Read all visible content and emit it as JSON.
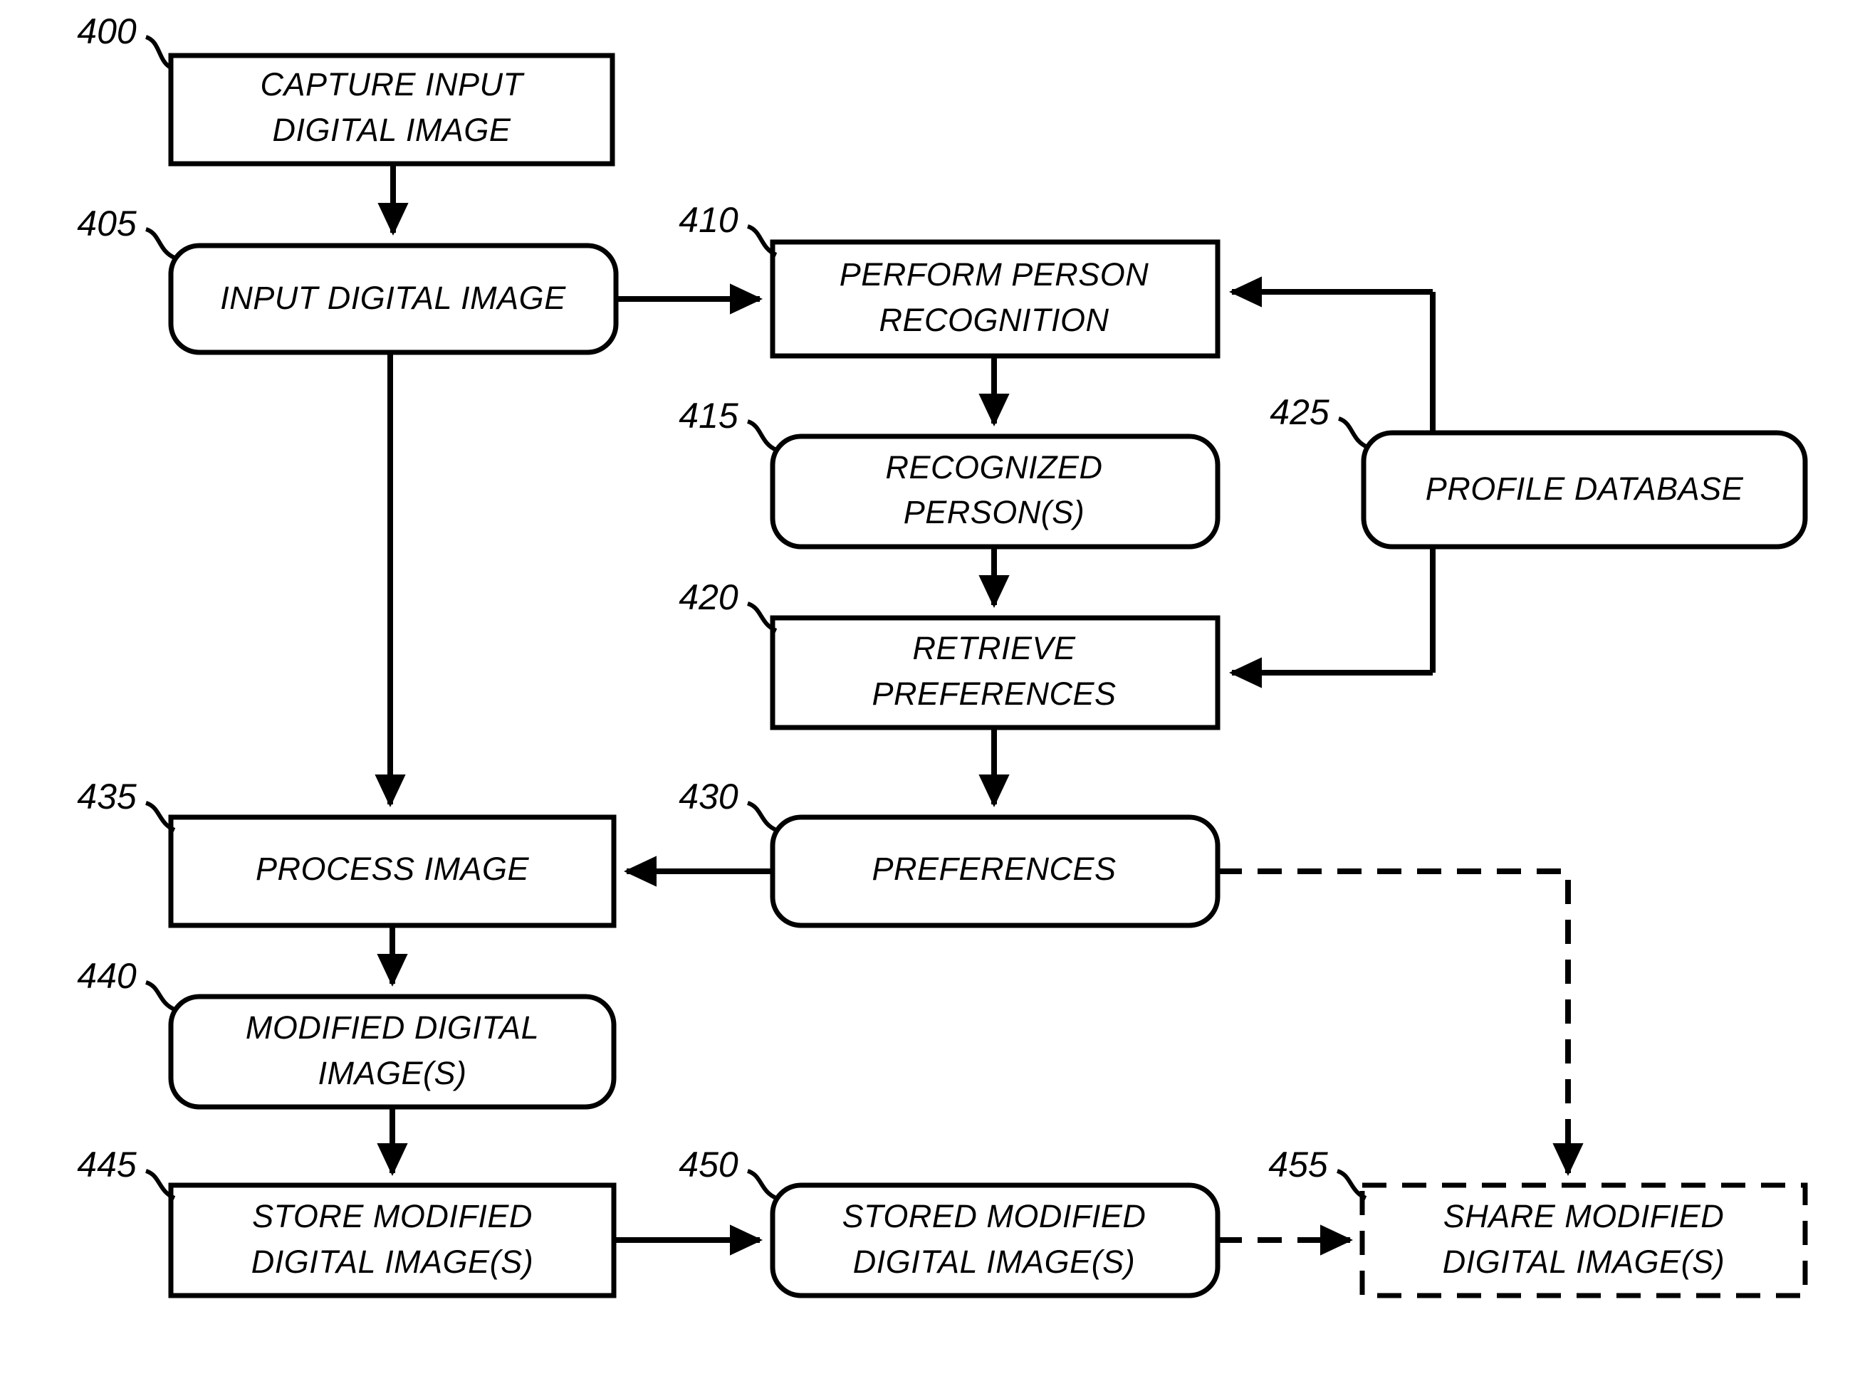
{
  "figure": {
    "type": "patent-flowchart",
    "nodes": [
      {
        "ref": "400",
        "label_lines": [
          "CAPTURE INPUT",
          "DIGITAL IMAGE"
        ],
        "shape": "rectangle",
        "line_style": "solid"
      },
      {
        "ref": "405",
        "label_lines": [
          "INPUT DIGITAL IMAGE"
        ],
        "shape": "rounded-rectangle",
        "line_style": "solid"
      },
      {
        "ref": "410",
        "label_lines": [
          "PERFORM PERSON",
          "RECOGNITION"
        ],
        "shape": "rectangle",
        "line_style": "solid"
      },
      {
        "ref": "415",
        "label_lines": [
          "RECOGNIZED",
          "PERSON(S)"
        ],
        "shape": "rounded-rectangle",
        "line_style": "solid"
      },
      {
        "ref": "420",
        "label_lines": [
          "RETRIEVE",
          "PREFERENCES"
        ],
        "shape": "rectangle",
        "line_style": "solid"
      },
      {
        "ref": "425",
        "label_lines": [
          "PROFILE DATABASE"
        ],
        "shape": "rounded-rectangle",
        "line_style": "solid"
      },
      {
        "ref": "430",
        "label_lines": [
          "PREFERENCES"
        ],
        "shape": "rounded-rectangle",
        "line_style": "solid"
      },
      {
        "ref": "435",
        "label_lines": [
          "PROCESS IMAGE"
        ],
        "shape": "rectangle",
        "line_style": "solid"
      },
      {
        "ref": "440",
        "label_lines": [
          "MODIFIED DIGITAL",
          "IMAGE(S)"
        ],
        "shape": "rounded-rectangle",
        "line_style": "solid"
      },
      {
        "ref": "445",
        "label_lines": [
          "STORE MODIFIED",
          "DIGITAL IMAGE(S)"
        ],
        "shape": "rectangle",
        "line_style": "solid"
      },
      {
        "ref": "450",
        "label_lines": [
          "STORED MODIFIED",
          "DIGITAL IMAGE(S)"
        ],
        "shape": "rounded-rectangle",
        "line_style": "solid"
      },
      {
        "ref": "455",
        "label_lines": [
          "SHARE MODIFIED",
          "DIGITAL IMAGE(S)"
        ],
        "shape": "rectangle",
        "line_style": "dashed"
      }
    ],
    "edges": [
      {
        "from": "400",
        "to": "405",
        "style": "solid"
      },
      {
        "from": "405",
        "to": "410",
        "style": "solid"
      },
      {
        "from": "405",
        "to": "435",
        "style": "solid"
      },
      {
        "from": "410",
        "to": "415",
        "style": "solid"
      },
      {
        "from": "415",
        "to": "420",
        "style": "solid"
      },
      {
        "from": "425",
        "to": "410",
        "style": "solid"
      },
      {
        "from": "425",
        "to": "420",
        "style": "solid"
      },
      {
        "from": "420",
        "to": "430",
        "style": "solid"
      },
      {
        "from": "430",
        "to": "435",
        "style": "solid"
      },
      {
        "from": "430",
        "to": "455",
        "style": "dashed"
      },
      {
        "from": "435",
        "to": "440",
        "style": "solid"
      },
      {
        "from": "440",
        "to": "445",
        "style": "solid"
      },
      {
        "from": "445",
        "to": "450",
        "style": "solid"
      },
      {
        "from": "450",
        "to": "455",
        "style": "dashed"
      }
    ],
    "labels": {
      "n400_l1": "CAPTURE INPUT",
      "n400_l2": "DIGITAL IMAGE",
      "n405_l1": "INPUT DIGITAL IMAGE",
      "n410_l1": "PERFORM PERSON",
      "n410_l2": "RECOGNITION",
      "n415_l1": "RECOGNIZED",
      "n415_l2": "PERSON(S)",
      "n420_l1": "RETRIEVE",
      "n420_l2": "PREFERENCES",
      "n425_l1": "PROFILE DATABASE",
      "n430_l1": "PREFERENCES",
      "n435_l1": "PROCESS IMAGE",
      "n440_l1": "MODIFIED DIGITAL",
      "n440_l2": "IMAGE(S)",
      "n445_l1": "STORE MODIFIED",
      "n445_l2": "DIGITAL IMAGE(S)",
      "n450_l1": "STORED MODIFIED",
      "n450_l2": "DIGITAL IMAGE(S)",
      "n455_l1": "SHARE MODIFIED",
      "n455_l2": "DIGITAL IMAGE(S)"
    },
    "refs": {
      "r400": "400",
      "r405": "405",
      "r410": "410",
      "r415": "415",
      "r420": "420",
      "r425": "425",
      "r430": "430",
      "r435": "435",
      "r440": "440",
      "r445": "445",
      "r450": "450",
      "r455": "455"
    },
    "colors": {
      "stroke": "#000000",
      "fill": "#ffffff"
    }
  }
}
